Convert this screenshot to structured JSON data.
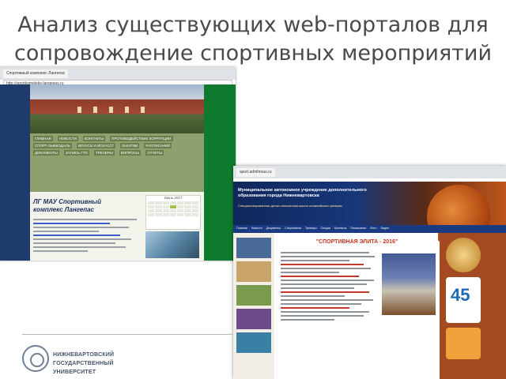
{
  "slide": {
    "title_line1": "Анализ существующих web-порталов для",
    "title_line2": "сопровождение спортивных мероприятий"
  },
  "screenshot1": {
    "tab_label": "Спортивный комплекс Лангепас",
    "url": "http://sportkompleks-langepas.ru",
    "heading": "ЛГ МАУ Спортивный комплекс Лангепас",
    "calendar_title": "Июнь 2017",
    "nav_items": [
      "ГЛАВНАЯ",
      "НОВОСТИ",
      "КОНТАКТЫ",
      "ПРОТИВОДЕЙСТВИЕ КОРРУПЦИИ",
      "СПОРТ-ЗЫБКОДАЛЬ",
      "ИСКУСИ И ИСКУССТ",
      "ЗАКУПКИ",
      "РАСПИСАНИЕ",
      "ДОКУМЕНТЫ",
      "ЗАПИСЬ ГТО",
      "ТРЕНЕРЫ",
      "ВОПРОСЫ",
      "ОТЧЕТЫ"
    ]
  },
  "screenshot2": {
    "tab_label": "sport.admhmao.ru",
    "banner_title": "Муниципальное автономное учреждение дополнительного образования города Нижневартовска",
    "banner_sub": "Специализированная детско-юношеская школа олимпийского резерва",
    "main_title": "\"СПОРТИВНАЯ ЭЛИТА - 2016\"",
    "logo_number": "45",
    "nav_items": [
      "Главная",
      "Новости",
      "Документы",
      "Спортсмены",
      "Тренеры",
      "Секции",
      "Контакты",
      "Расписание",
      "Фото",
      "Видео"
    ]
  },
  "footer": {
    "university_line1": "НИЖНЕВАРТОВСКИЙ",
    "university_line2": "ГОСУДАРСТВЕННЫЙ УНИВЕРСИТЕТ"
  }
}
